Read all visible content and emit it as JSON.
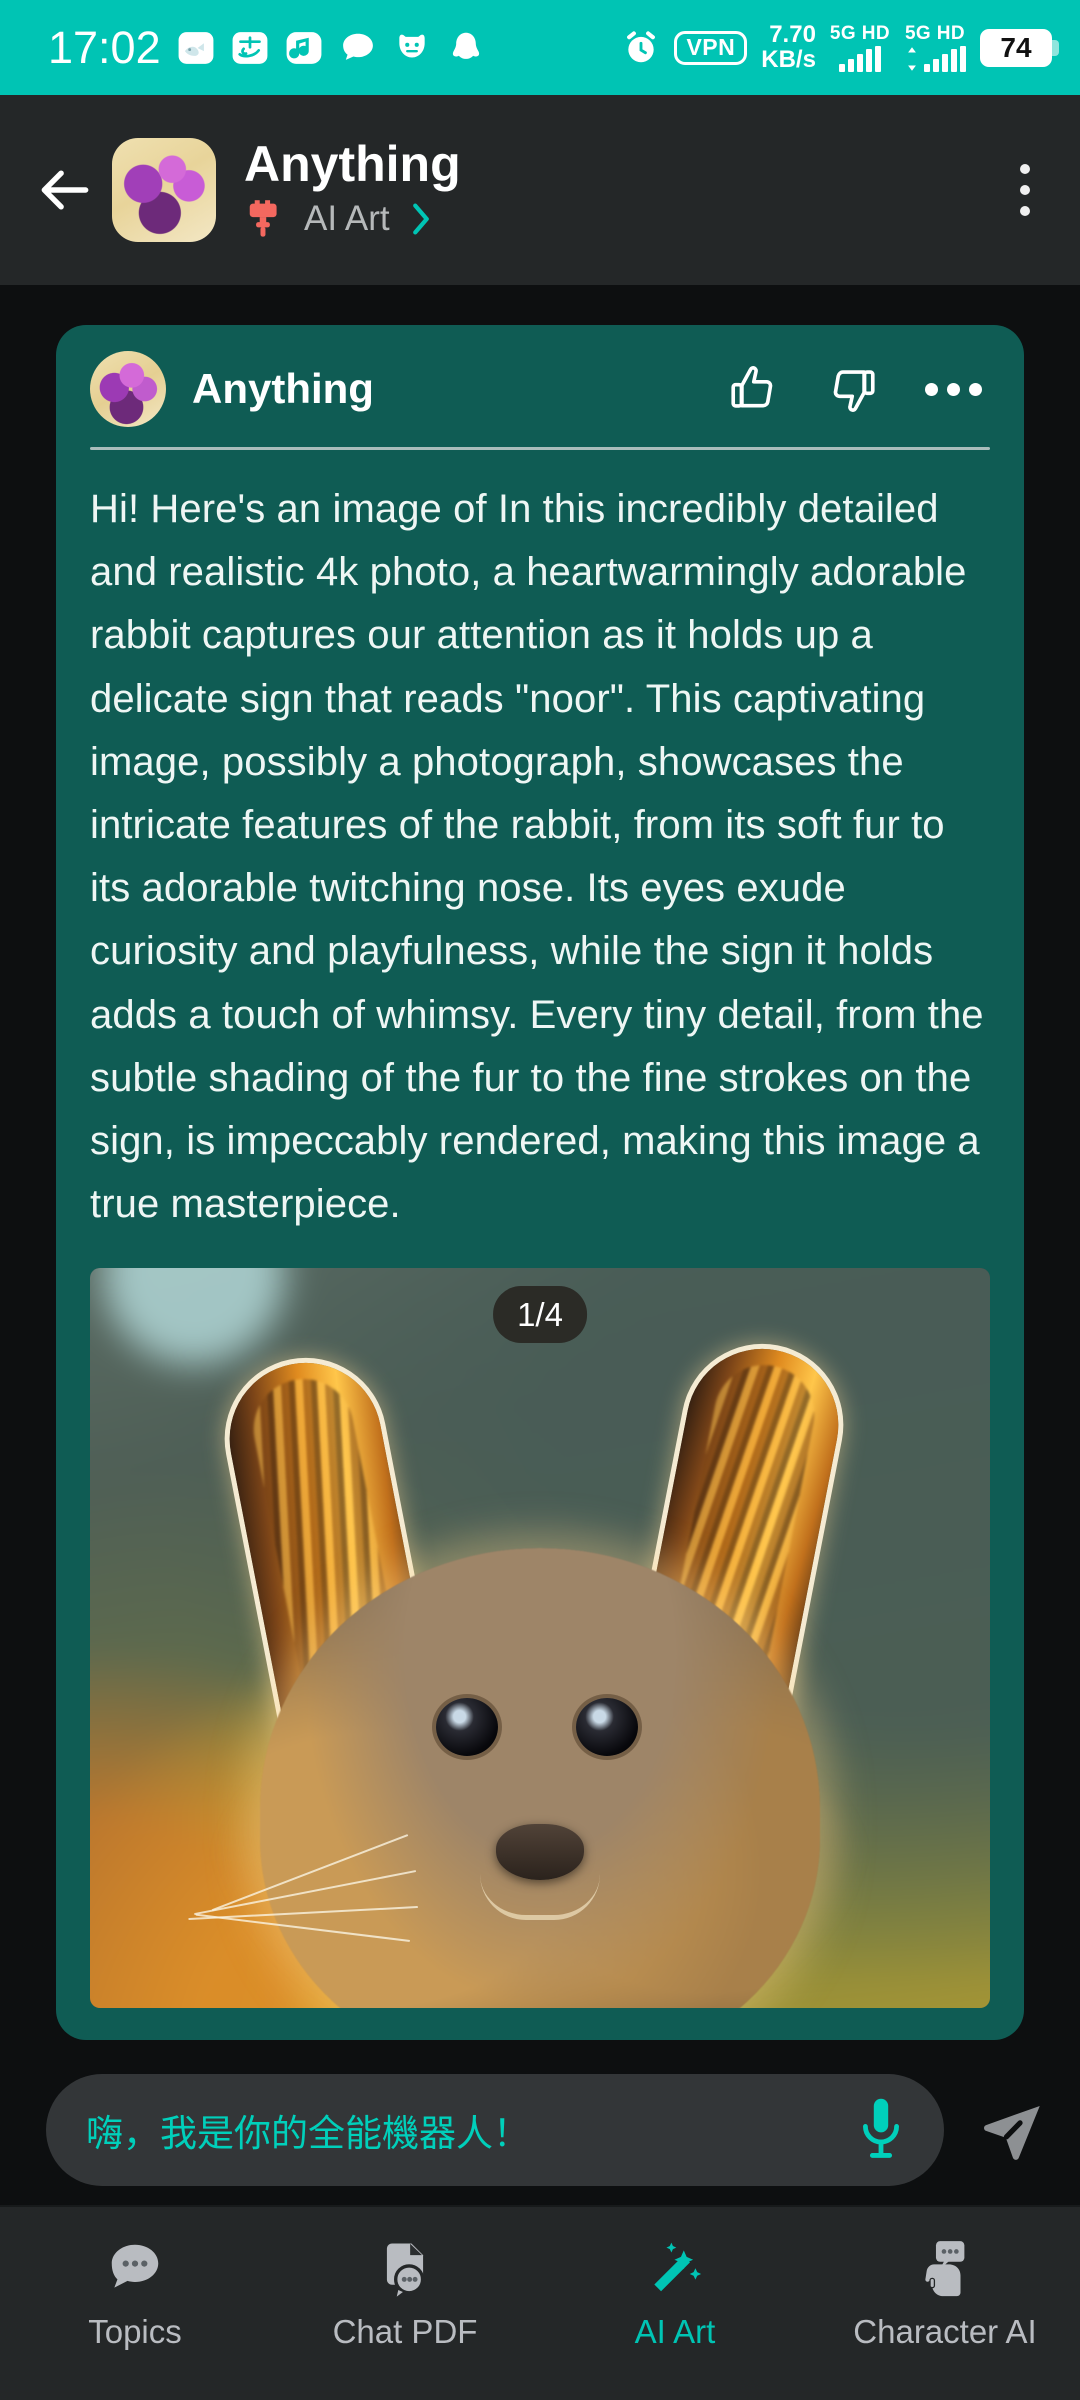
{
  "status_bar": {
    "time": "17:02",
    "icons": [
      "whale-icon",
      "alipay-icon",
      "music-note-icon",
      "chat-bubble-icon",
      "mask-icon",
      "qq-penguin-icon"
    ],
    "alarm_icon": "alarm-icon",
    "vpn_label": "VPN",
    "net_speed_value": "7.70",
    "net_speed_unit": "KB/s",
    "sim1_label": "5G HD",
    "sim2_label": "5G HD",
    "battery_level": "74",
    "bg_color": "#00c4b4"
  },
  "header": {
    "back_icon": "back-arrow-icon",
    "avatar": "character-avatar",
    "title": "Anything",
    "mode_icon": "paint-roller-icon",
    "mode_label": "AI Art",
    "chevron_icon": "chevron-right-icon",
    "menu_icon": "more-vertical-icon",
    "accent_color": "#00c4b4",
    "mode_icon_color": "#f4685f"
  },
  "message_card": {
    "avatar": "character-avatar",
    "sender": "Anything",
    "like_icon": "thumbs-up-icon",
    "dislike_icon": "thumbs-down-icon",
    "more_icon": "more-horizontal-icon",
    "body": "Hi! Here's an image of In this incredibly detailed and realistic 4k photo, a heartwarmingly adorable rabbit captures our attention as it holds up a delicate sign that reads \"noor\". This captivating image, possibly a photograph, showcases the intricate features of the rabbit, from its soft fur to its adorable twitching nose. Its eyes exude curiosity and playfulness, while the sign it holds adds a touch of whimsy. Every tiny detail, from the subtle shading of the fur to the fine strokes on the sign, is impeccably rendered, making this image a true masterpiece.",
    "image_counter": "1/4",
    "image_alt": "backlit-rabbit-photo",
    "card_color": "#0f5c54"
  },
  "input_bar": {
    "placeholder": "嗨，我是你的全能機器人！",
    "mic_icon": "microphone-icon",
    "send_icon": "send-icon",
    "placeholder_color": "#00d0bb"
  },
  "bottom_nav": {
    "items": [
      {
        "label": "Topics",
        "icon": "topics-bubble-icon",
        "active": false
      },
      {
        "label": "Chat PDF",
        "icon": "chat-pdf-icon",
        "active": false
      },
      {
        "label": "AI Art",
        "icon": "magic-wand-icon",
        "active": true
      },
      {
        "label": "Character AI",
        "icon": "character-ai-icon",
        "active": false
      }
    ],
    "active_color": "#00c4b4",
    "inactive_color": "#b9bcc1"
  }
}
